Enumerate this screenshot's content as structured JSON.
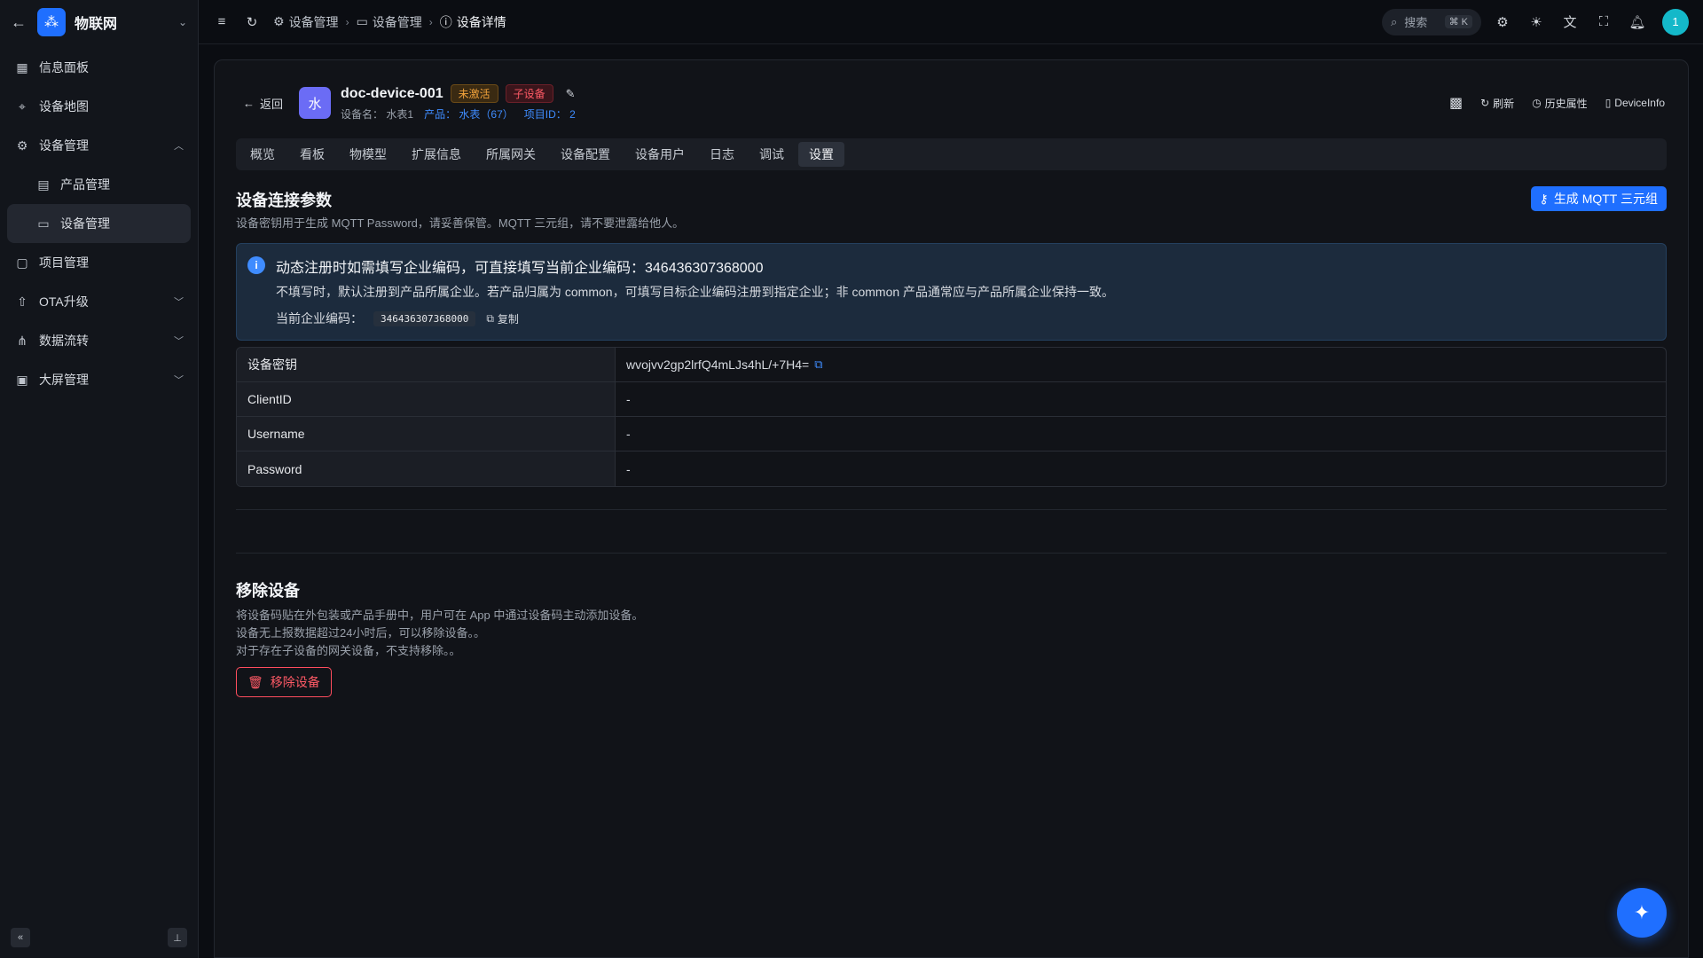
{
  "app": {
    "name": "物联网"
  },
  "sidebar": {
    "items": [
      {
        "label": "信息面板"
      },
      {
        "label": "设备地图"
      },
      {
        "label": "设备管理"
      },
      {
        "label": "产品管理"
      },
      {
        "label": "设备管理"
      },
      {
        "label": "项目管理"
      },
      {
        "label": "OTA升级"
      },
      {
        "label": "数据流转"
      },
      {
        "label": "大屏管理"
      }
    ]
  },
  "topbar": {
    "breadcrumbs": [
      "设备管理",
      "设备管理",
      "设备详情"
    ],
    "search_placeholder": "搜索",
    "search_shortcut": "⌘ K",
    "avatar_text": "1"
  },
  "device": {
    "back_label": "返回",
    "avatar_char": "水",
    "name": "doc-device-001",
    "status_tag": "未激活",
    "type_tag": "子设备",
    "meta_name_label": "设备名：",
    "meta_name_value": "水表1",
    "meta_product_label": "产品：",
    "meta_product_value": "水表（67）",
    "meta_project_label": "项目ID：",
    "meta_project_value": "2",
    "actions": {
      "refresh": "刷新",
      "history": "历史属性",
      "device_info": "DeviceInfo"
    }
  },
  "tabs": [
    "概览",
    "看板",
    "物模型",
    "扩展信息",
    "所属网关",
    "设备配置",
    "设备用户",
    "日志",
    "调试",
    "设置"
  ],
  "active_tab": "设置",
  "connection": {
    "title": "设备连接参数",
    "desc": "设备密钥用于生成 MQTT Password，请妥善保管。MQTT 三元组，请不要泄露给他人。",
    "button": "生成 MQTT 三元组",
    "alert_title": "动态注册时如需填写企业编码，可直接填写当前企业编码：346436307368000",
    "alert_body": "不填写时，默认注册到产品所属企业。若产品归属为 common，可填写目标企业编码注册到指定企业；非 common 产品通常应与产品所属企业保持一致。",
    "alert_code_label": "当前企业编码：",
    "alert_code": "346436307368000",
    "alert_copy": "复制",
    "rows": [
      {
        "key": "设备密钥",
        "value": "wvojvv2gp2lrfQ4mLJs4hL/+7H4="
      },
      {
        "key": "ClientID",
        "value": "-"
      },
      {
        "key": "Username",
        "value": "-"
      },
      {
        "key": "Password",
        "value": "-"
      }
    ]
  },
  "remove": {
    "title": "移除设备",
    "lines": [
      "将设备码贴在外包装或产品手册中，用户可在 App 中通过设备码主动添加设备。",
      "设备无上报数据超过24小时后，可以移除设备。。",
      "对于存在子设备的网关设备，不支持移除。。"
    ],
    "button": "移除设备"
  },
  "colors": {
    "accent": "#1f6fff",
    "danger": "#ff4d5e",
    "warning": "#f0a13a"
  }
}
